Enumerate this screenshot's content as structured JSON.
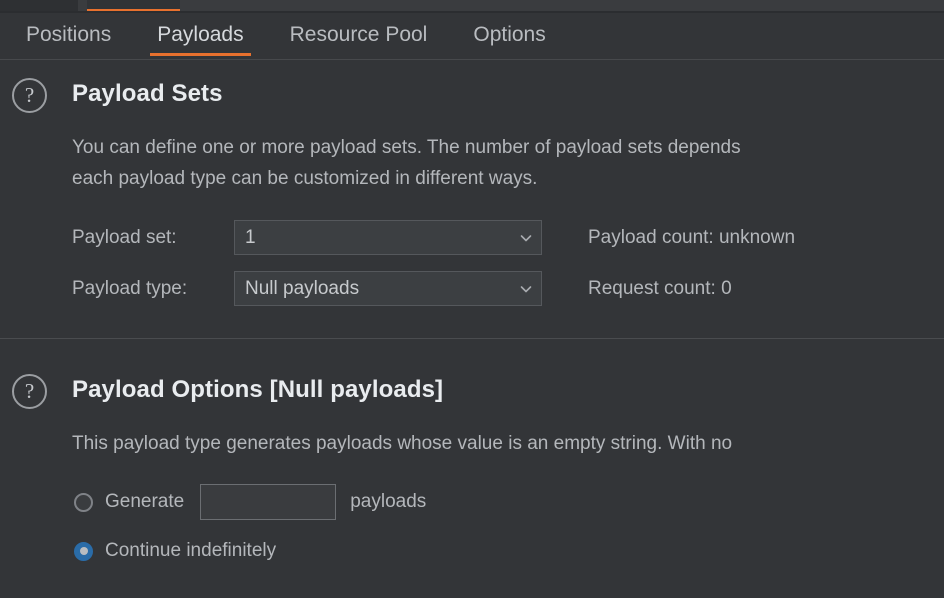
{
  "window_tabs": {
    "inactive_tab_label": "",
    "active_tab_label": "",
    "accent_color": "#e8712e"
  },
  "tabbar": {
    "tabs": [
      {
        "label": "Positions",
        "active": false
      },
      {
        "label": "Payloads",
        "active": true
      },
      {
        "label": "Resource Pool",
        "active": false
      },
      {
        "label": "Options",
        "active": false
      }
    ],
    "active_indicator_color": "#e8712e"
  },
  "payload_sets": {
    "help_icon": "?",
    "title": "Payload Sets",
    "description": "You can define one or more payload sets. The number of payload sets depends\neach payload type can be customized in different ways.",
    "payload_set": {
      "label": "Payload set:",
      "value": "1",
      "chevron": "chevron-down-icon"
    },
    "payload_type": {
      "label": "Payload type:",
      "value": "Null payloads",
      "chevron": "chevron-down-icon"
    },
    "payload_count": "Payload count: unknown",
    "request_count": "Request count: 0"
  },
  "payload_options": {
    "help_icon": "?",
    "title": "Payload Options [Null payloads]",
    "description": "This payload type generates payloads whose value is an empty string. With no",
    "generate": {
      "label": "Generate",
      "selected": false,
      "input_value": "",
      "input_placeholder": "",
      "suffix_label": "payloads"
    },
    "continue_indefinitely": {
      "label": "Continue indefinitely",
      "selected": true,
      "selected_color": "#2a6ca8"
    }
  }
}
